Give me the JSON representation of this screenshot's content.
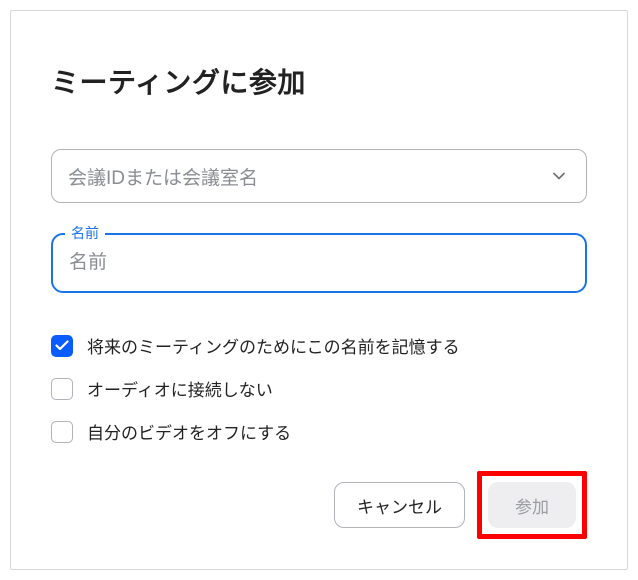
{
  "title": "ミーティングに参加",
  "meeting_id": {
    "placeholder": "会議IDまたは会議室名"
  },
  "name_field": {
    "label": "名前",
    "placeholder": "名前",
    "value": ""
  },
  "options": [
    {
      "label": "将来のミーティングのためにこの名前を記憶する",
      "checked": true
    },
    {
      "label": "オーディオに接続しない",
      "checked": false
    },
    {
      "label": "自分のビデオをオフにする",
      "checked": false
    }
  ],
  "buttons": {
    "cancel": "キャンセル",
    "join": "参加"
  }
}
